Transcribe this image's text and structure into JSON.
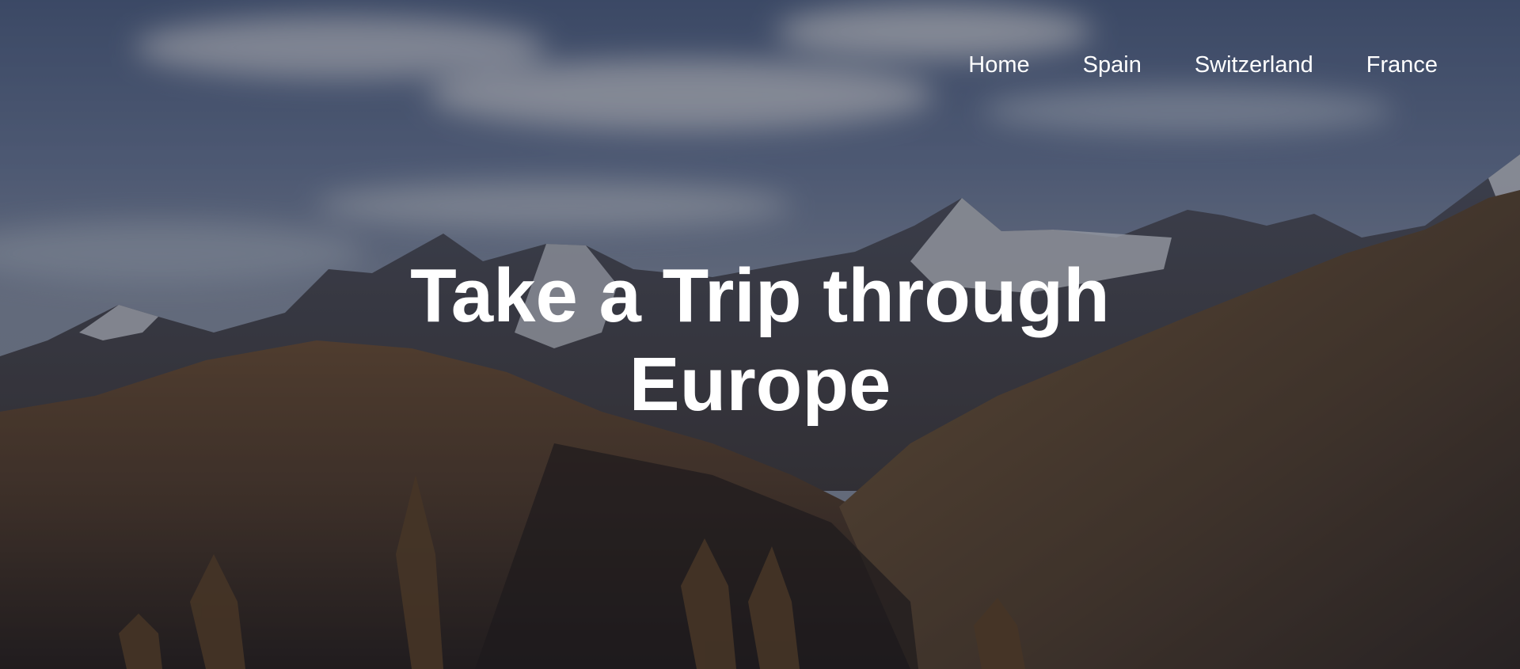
{
  "nav": {
    "items": [
      {
        "label": "Home"
      },
      {
        "label": "Spain"
      },
      {
        "label": "Switzerland"
      },
      {
        "label": "France"
      }
    ]
  },
  "hero": {
    "title_line1": "Take a Trip through",
    "title_line2": "Europe"
  },
  "colors": {
    "text": "#ffffff",
    "overlay": "rgba(10,14,28,0.38)"
  }
}
